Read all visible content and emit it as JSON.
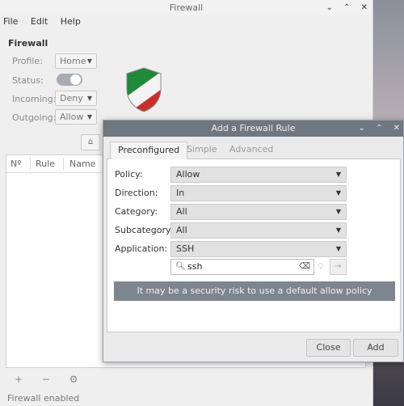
{
  "main": {
    "title": "Firewall",
    "menu": [
      "File",
      "Edit",
      "Help"
    ],
    "section_title": "Firewall",
    "labels": {
      "profile": "Profile:",
      "status": "Status:",
      "incoming": "Incoming:",
      "outgoing": "Outgoing:"
    },
    "values": {
      "profile": "Home",
      "incoming": "Deny",
      "outgoing": "Allow"
    },
    "status_on": true,
    "columns": [
      "Nº",
      "Rule",
      "Name"
    ],
    "tools": {
      "add": "+",
      "remove": "−",
      "settings": "⚙"
    },
    "statusbar": "Firewall enabled"
  },
  "window_controls": {
    "minimize": "⌄",
    "maximize": "⌃",
    "close": "✕"
  },
  "dialog": {
    "title": "Add a Firewall Rule",
    "tabs": [
      "Preconfigured",
      "Simple",
      "Advanced"
    ],
    "active_tab": "Preconfigured",
    "fields": [
      {
        "label": "Policy:",
        "value": "Allow"
      },
      {
        "label": "Direction:",
        "value": "In"
      },
      {
        "label": "Category:",
        "value": "All"
      },
      {
        "label": "Subcategory:",
        "value": "All"
      },
      {
        "label": "Application:",
        "value": "SSH"
      }
    ],
    "search_value": "ssh",
    "warning": "It may be a security risk to use a default allow policy",
    "close_label": "Close",
    "add_label": "Add"
  },
  "colors": {
    "dialog_title_bg": "#6f7780",
    "warning_bg": "#7d858e",
    "toggle_on": "#a7acb4"
  }
}
